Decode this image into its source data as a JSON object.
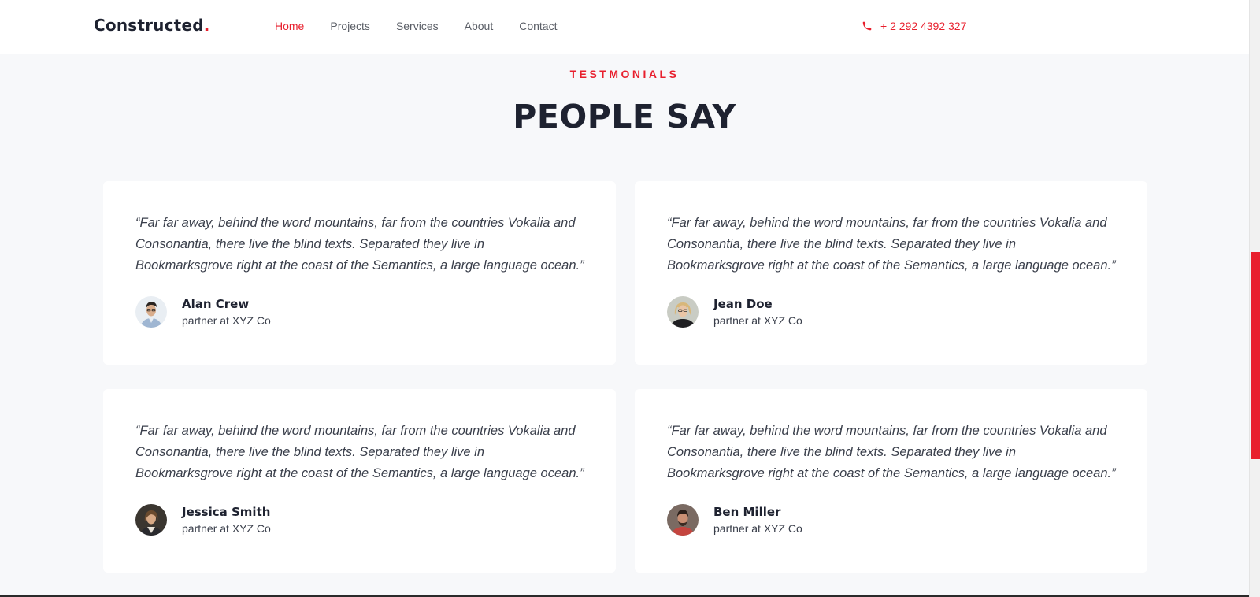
{
  "brand": {
    "name": "Constructed",
    "dot": "."
  },
  "nav": {
    "links": [
      "Home",
      "Projects",
      "Services",
      "About",
      "Contact"
    ],
    "active": "Home",
    "phone": "+ 2 292 4392 327"
  },
  "section": {
    "eyebrow": "TESTMONIALS",
    "title": "PEOPLE SAY"
  },
  "testimonials": [
    {
      "quote": "“Far far away, behind the word mountains, far from the countries Vokalia and Consonantia, there live the blind texts. Separated they live in Bookmarksgrove right at the coast of the Semantics, a large language ocean.”",
      "name": "Alan Crew",
      "role": "partner at XYZ Co"
    },
    {
      "quote": "“Far far away, behind the word mountains, far from the countries Vokalia and Consonantia, there live the blind texts. Separated they live in Bookmarksgrove right at the coast of the Semantics, a large language ocean.”",
      "name": "Jean Doe",
      "role": "partner at XYZ Co"
    },
    {
      "quote": "“Far far away, behind the word mountains, far from the countries Vokalia and Consonantia, there live the blind texts. Separated they live in Bookmarksgrove right at the coast of the Semantics, a large language ocean.”",
      "name": "Jessica Smith",
      "role": "partner at XYZ Co"
    },
    {
      "quote": "“Far far away, behind the word mountains, far from the countries Vokalia and Consonantia, there live the blind texts. Separated they live in Bookmarksgrove right at the coast of the Semantics, a large language ocean.”",
      "name": "Ben Miller",
      "role": "partner at XYZ Co"
    }
  ],
  "colors": {
    "accent": "#e81f2d",
    "dark": "#1e2230",
    "background": "#f7f8fa"
  },
  "icons": {
    "phone": "phone-icon"
  }
}
